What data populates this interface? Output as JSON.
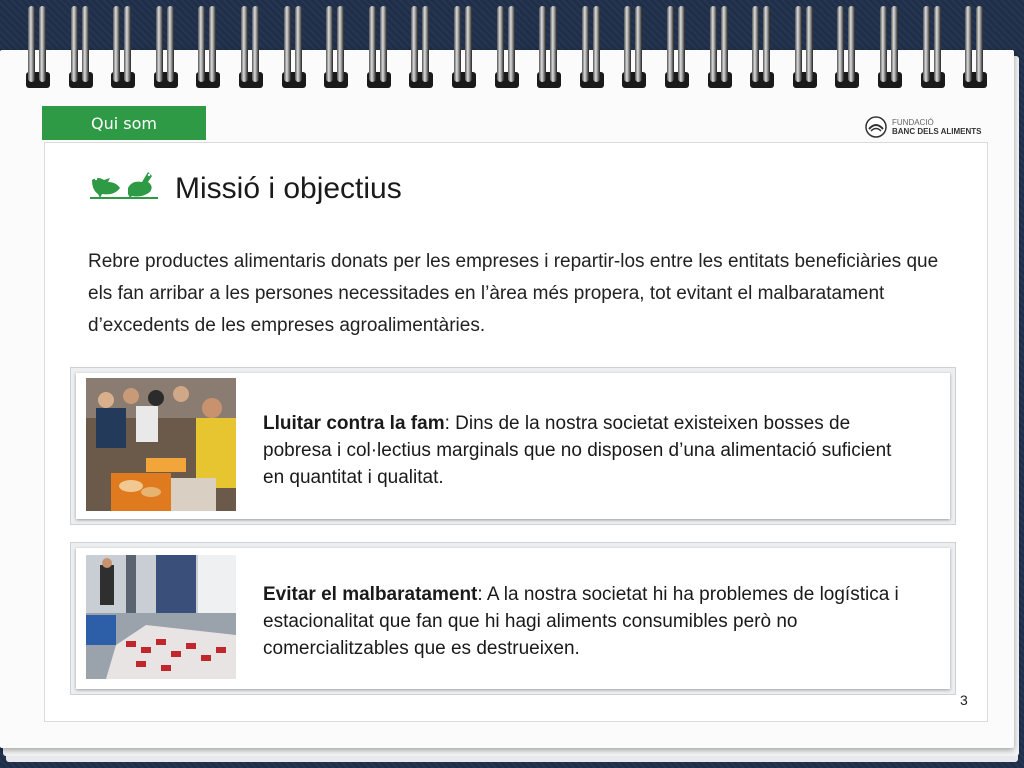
{
  "section_tab": {
    "label": "Qui som"
  },
  "logo": {
    "line1": "FUNDACIÓ",
    "line2": "BANC DELS ALIMENTS"
  },
  "title": "Missió i objectius",
  "title_icon": "birds-icon",
  "intro": "Rebre productes alimentaris donats per les empreses i repartir-los entre les entitats beneficiàries que els fan arribar a les persones necessitades en l’àrea més propera, tot evitant el malbaratament d’excedents de les empreses agroalimentàries.",
  "cards": [
    {
      "heading": "Lluitar contra la fam",
      "text": ": Dins de la nostra societat existeixen bosses de pobresa i col·lectius marginals que no disposen d’una alimentació suficient en quantitat i qualitat."
    },
    {
      "heading": "Evitar el malbaratament",
      "text": ": A la nostra societat hi ha problemes de logística i estacionalitat que fan que hi hagi aliments consumibles però no comercialitzables que es destrueixen."
    }
  ],
  "page_number": "3",
  "colors": {
    "accent_green": "#2e9a45",
    "background": "#1f2f4a"
  }
}
